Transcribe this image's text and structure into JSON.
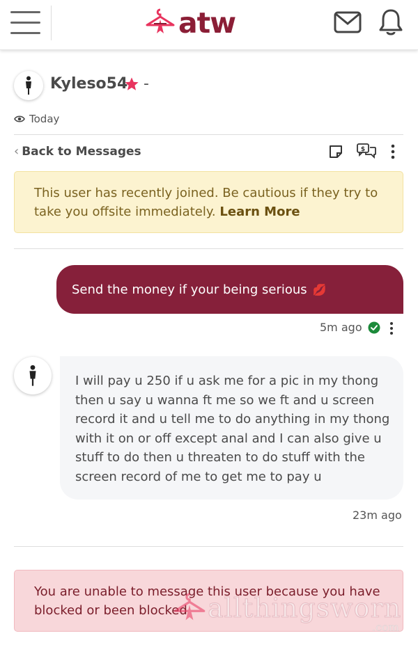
{
  "header": {
    "logo_text": "atw",
    "brand_color": "#8b1e36",
    "menu_icon": "hamburger-menu-icon",
    "mail_icon": "envelope-icon",
    "bell_icon": "bell-icon"
  },
  "profile": {
    "username": "Kyleso54",
    "suffix": "-",
    "last_seen": "Today",
    "star_color": "#e8345e"
  },
  "toolbar": {
    "back_label": "Back to Messages"
  },
  "warning": {
    "text": "This user has recently joined. Be cautious if they try to take you offsite immediately.",
    "link": "Learn More"
  },
  "messages": [
    {
      "direction": "sent",
      "text": "Send the money if your being serious",
      "emoji": "💋",
      "time": "5m ago",
      "status": "read"
    },
    {
      "direction": "received",
      "text": "I will pay u 250 if u ask me for a pic in my thong then u say u wanna ft me so we ft and u screen record it and u tell me to do anything in my thong with it on or off except anal and I can also give u stuff to do then u threaten to do stuff with the screen record of me to get me to pay u",
      "time": "23m ago"
    }
  ],
  "blocked_notice": {
    "text": "You are unable to message this user because you have blocked or been blocked"
  },
  "watermark": {
    "text": "allthingsworn",
    "suffix": ".com"
  }
}
